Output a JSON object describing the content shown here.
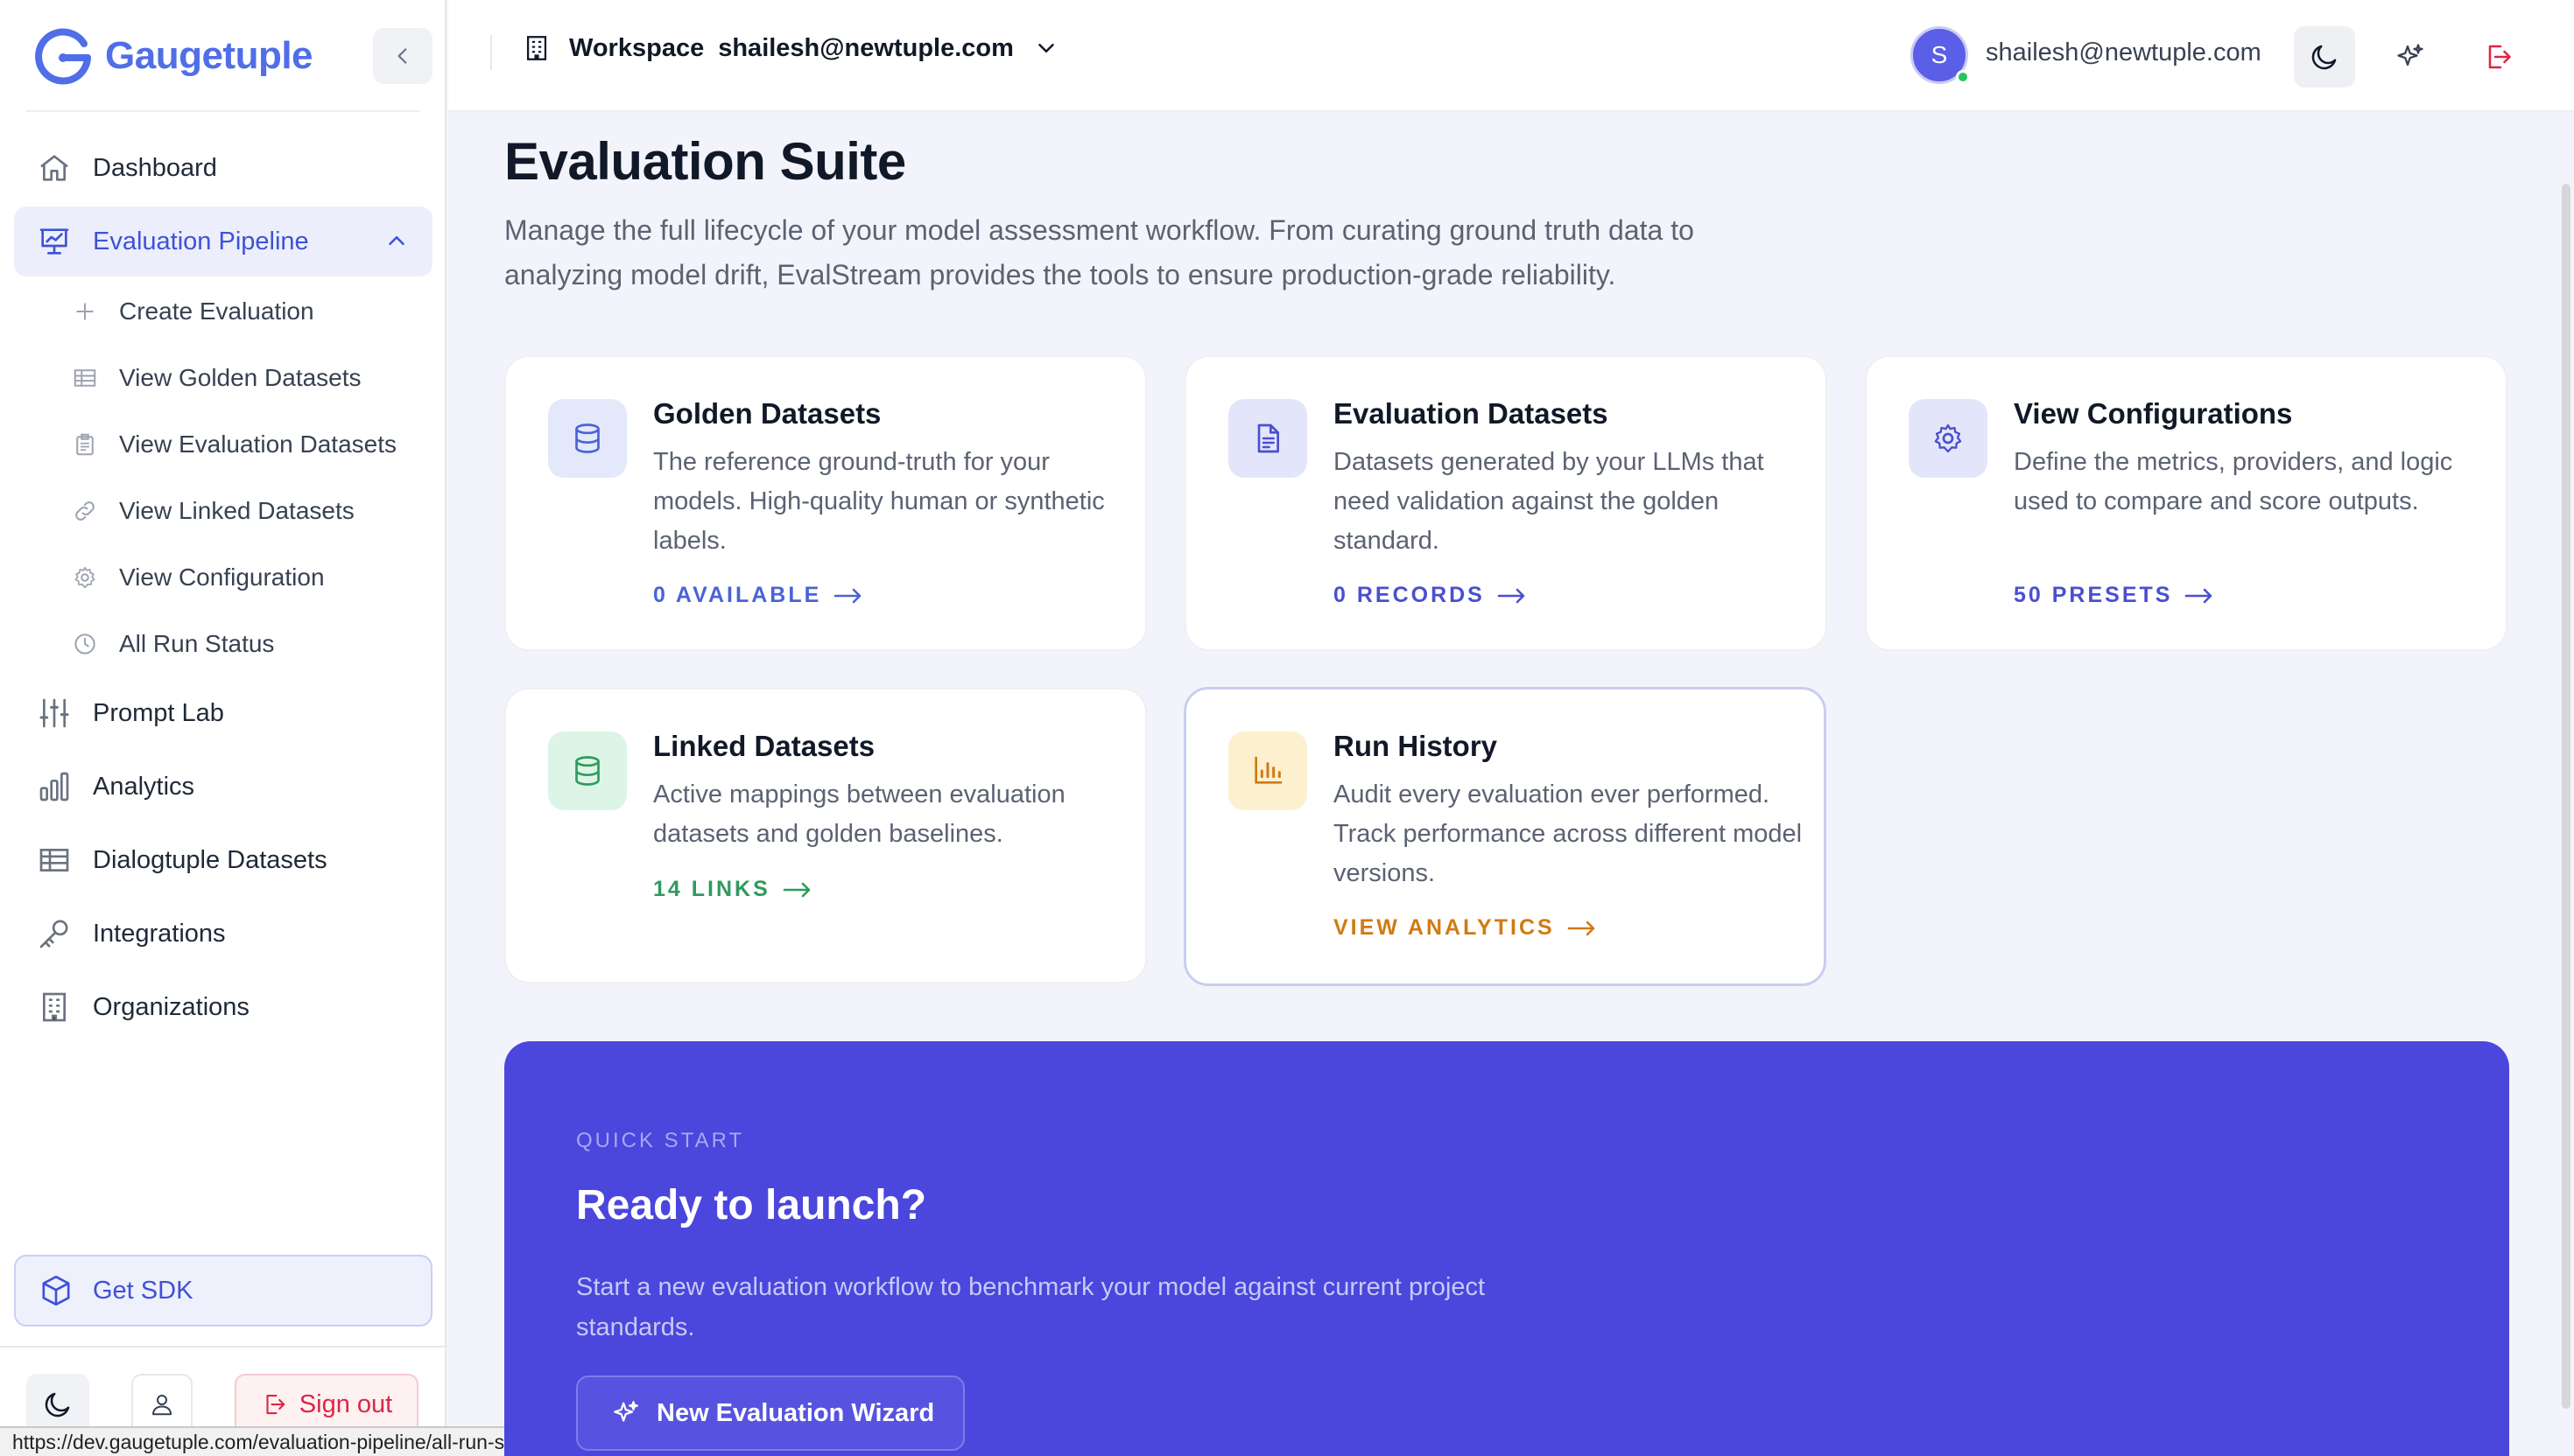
{
  "brand": {
    "name": "Gaugetuple",
    "accent": "#4f6ee8"
  },
  "sidebar": {
    "items": [
      {
        "label": "Dashboard",
        "icon": "home-icon"
      },
      {
        "label": "Evaluation Pipeline",
        "icon": "presentation-chart-icon",
        "active": true,
        "expanded": true
      },
      {
        "label": "Prompt Lab",
        "icon": "sliders-icon"
      },
      {
        "label": "Analytics",
        "icon": "bar-chart-icon"
      },
      {
        "label": "Dialogtuple Datasets",
        "icon": "table-icon"
      },
      {
        "label": "Integrations",
        "icon": "key-icon"
      },
      {
        "label": "Organizations",
        "icon": "building-icon"
      }
    ],
    "subitems": [
      {
        "label": "Create Evaluation",
        "icon": "plus-icon"
      },
      {
        "label": "View Golden Datasets",
        "icon": "table-icon"
      },
      {
        "label": "View Evaluation Datasets",
        "icon": "clipboard-icon"
      },
      {
        "label": "View Linked Datasets",
        "icon": "link-icon"
      },
      {
        "label": "View Configuration",
        "icon": "gear-icon"
      },
      {
        "label": "All Run Status",
        "icon": "clock-icon"
      }
    ],
    "sdk_label": "Get SDK",
    "signout_label": "Sign out"
  },
  "header": {
    "workspace_label": "Workspace",
    "workspace_email": "shailesh@newtuple.com",
    "user_initial": "S",
    "user_email": "shailesh@newtuple.com"
  },
  "main": {
    "title": "Evaluation Suite",
    "description": "Manage the full lifecycle of your model assessment workflow. From curating ground truth data to analyzing model drift, EvalStream provides the tools to ensure production-grade reliability.",
    "cards": [
      {
        "title": "Golden Datasets",
        "description": "The reference ground-truth for your models. High-quality human or synthetic labels.",
        "link": "0 AVAILABLE",
        "color": "#4a63d6",
        "icon_bg": "#e3e8fb",
        "icon": "database-icon"
      },
      {
        "title": "Evaluation Datasets",
        "description": "Datasets generated by your LLMs that need validation against the golden standard.",
        "link": "0 RECORDS",
        "color": "#4a4fd0",
        "icon_bg": "#e3e6fb",
        "icon": "document-icon"
      },
      {
        "title": "View Configurations",
        "description": "Define the metrics, providers, and logic used to compare and score outputs.",
        "link": "50 PRESETS",
        "color": "#4a4fd0",
        "icon_bg": "#e3e6fb",
        "icon": "gear-icon"
      },
      {
        "title": "Linked Datasets",
        "description": "Active mappings between evaluation datasets and golden baselines.",
        "link": "14 LINKS",
        "color": "#2f9a5e",
        "icon_bg": "#dcf5e6",
        "icon": "database-icon"
      },
      {
        "title": "Run History",
        "description": "Audit every evaluation ever performed. Track performance across different model versions.",
        "link": "VIEW ANALYTICS",
        "color": "#d17a12",
        "icon_bg": "#fdf0cf",
        "icon": "bar-chart-icon"
      }
    ]
  },
  "quick_start": {
    "eyebrow": "QUICK START",
    "title": "Ready to launch?",
    "description": "Start a new evaluation workflow to benchmark your model against current project standards.",
    "button_label": "New Evaluation Wizard",
    "bg": "#4b46dc"
  },
  "status_bar": {
    "url": "https://dev.gaugetuple.com/evaluation-pipeline/all-run-status"
  }
}
